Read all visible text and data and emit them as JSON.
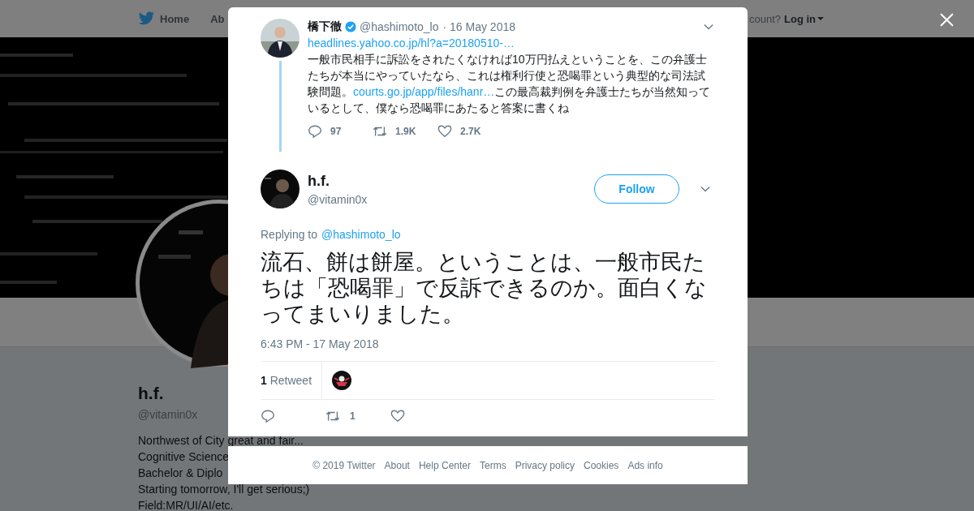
{
  "topbar": {
    "nav": [
      {
        "label": "Home"
      },
      {
        "label": "Ab"
      }
    ],
    "account_prompt": "count?",
    "login": "Log in"
  },
  "profile": {
    "name": "h.f.",
    "handle": "@vitamin0x",
    "bio": [
      "Northwest of City great and fair...",
      "Cognitive Science",
      "Bachelor & Diplo",
      "Starting tomorrow, I'll get serious;)",
      "Field:MR/UI/AI/etc."
    ]
  },
  "modal": {
    "parent_tweet": {
      "author": "橋下徹",
      "verified": true,
      "handle": "@hashimoto_lo",
      "date": "· 16 May 2018",
      "segments": [
        {
          "kind": "link",
          "text": "headlines.yahoo.co.jp/hl?a=20180510-…"
        },
        {
          "kind": "text",
          "text": "\n一般市民相手に訴訟をされたくなければ10万円払えということを、この弁護士たちが本当にやっていたなら、これは権利行使と恐喝罪という典型的な司法試験問題。"
        },
        {
          "kind": "link",
          "text": "courts.go.jp/app/files/hanr…"
        },
        {
          "kind": "text",
          "text": "この最高裁判例を弁護士たちが当然知っているとして、僕なら恐喝罪にあたると答案に書くね"
        }
      ],
      "stats": [
        {
          "kind": "reply",
          "count": "97"
        },
        {
          "kind": "retweet",
          "count": "1.9K"
        },
        {
          "kind": "like",
          "count": "2.7K"
        }
      ]
    },
    "tweet": {
      "name": "h.f.",
      "handle": "@vitamin0x",
      "follow": "Follow",
      "replying_label": "Replying to",
      "replying_to": "@hashimoto_lo",
      "text": "流石、餅は餅屋。ということは、一般市民たちは「恐喝罪」で反訴できるのか。面白くなってまいりました。",
      "timestamp": "6:43 PM - 17 May 2018",
      "retweets": "**1** Retweet",
      "actions": [
        {
          "kind": "reply"
        },
        {
          "kind": "retweet",
          "count": "1"
        },
        {
          "kind": "like"
        }
      ]
    }
  },
  "footer": [
    "© 2019 Twitter",
    "About",
    "Help Center",
    "Terms",
    "Privacy policy",
    "Cookies",
    "Ads info"
  ]
}
